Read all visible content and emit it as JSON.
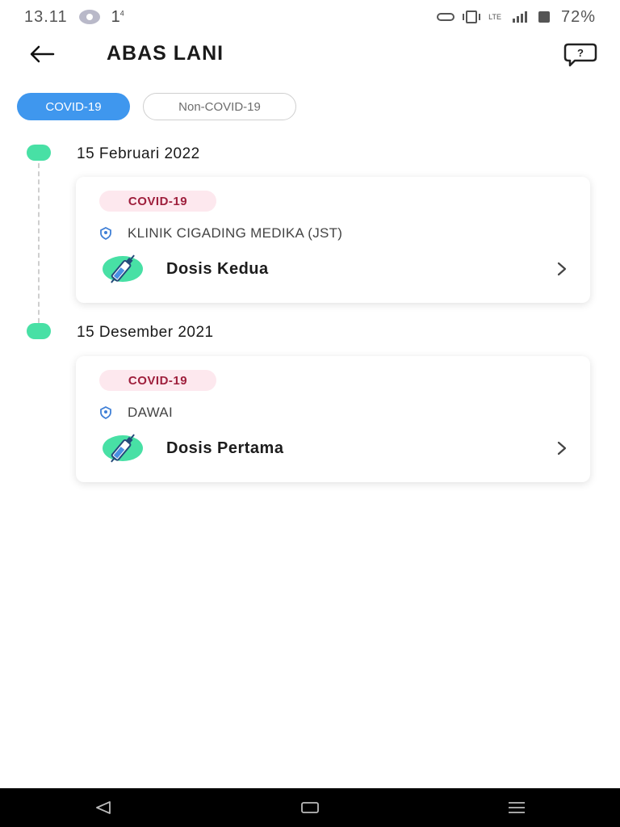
{
  "status_bar": {
    "time": "13.11",
    "notification_count": "1",
    "notification_superscript": "4",
    "network": "LTE",
    "battery": "72%"
  },
  "header": {
    "title": "ABAS LANI",
    "back_icon": "arrow-left-icon",
    "help_icon": "help-bubble-icon"
  },
  "tabs": [
    {
      "label": "COVID-19",
      "active": true
    },
    {
      "label": "Non-COVID-19",
      "active": false
    }
  ],
  "colors": {
    "accent": "#3f97ee",
    "timeline_dot": "#48e0a5",
    "badge_bg": "#fde8ee",
    "badge_text": "#9e1f3c"
  },
  "records": [
    {
      "date": "15 Februari 2022",
      "badge": "COVID-19",
      "location": "KLINIK CIGADING MEDIKA (JST)",
      "dose": "Dosis Kedua"
    },
    {
      "date": "15 Desember 2021",
      "badge": "COVID-19",
      "location": "DAWAI",
      "dose": "Dosis Pertama"
    }
  ],
  "nav": {
    "back_icon": "triangle-back-icon",
    "home_icon": "square-home-icon",
    "menu_icon": "menu-lines-icon"
  }
}
